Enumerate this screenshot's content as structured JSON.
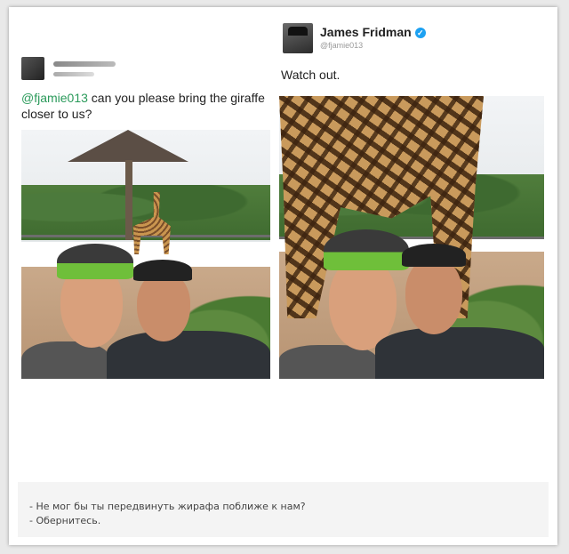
{
  "left_tweet": {
    "mention": "@fjamie013",
    "text": " can you please bring the giraffe closer to us?"
  },
  "right_tweet": {
    "name": "James Fridman",
    "handle": "@fjamie013",
    "verified_symbol": "✓",
    "text": "Watch out."
  },
  "caption": {
    "line1": "- Не мог бы ты передвинуть жирафа поближе к нам?",
    "line2": "- Обернитесь."
  },
  "colors": {
    "mention": "#2a9a5a",
    "verified": "#1da1f2",
    "frame_bg": "#ffffff",
    "page_bg": "#e9e9e9"
  },
  "icons": {
    "verified": "verified-badge-icon"
  }
}
